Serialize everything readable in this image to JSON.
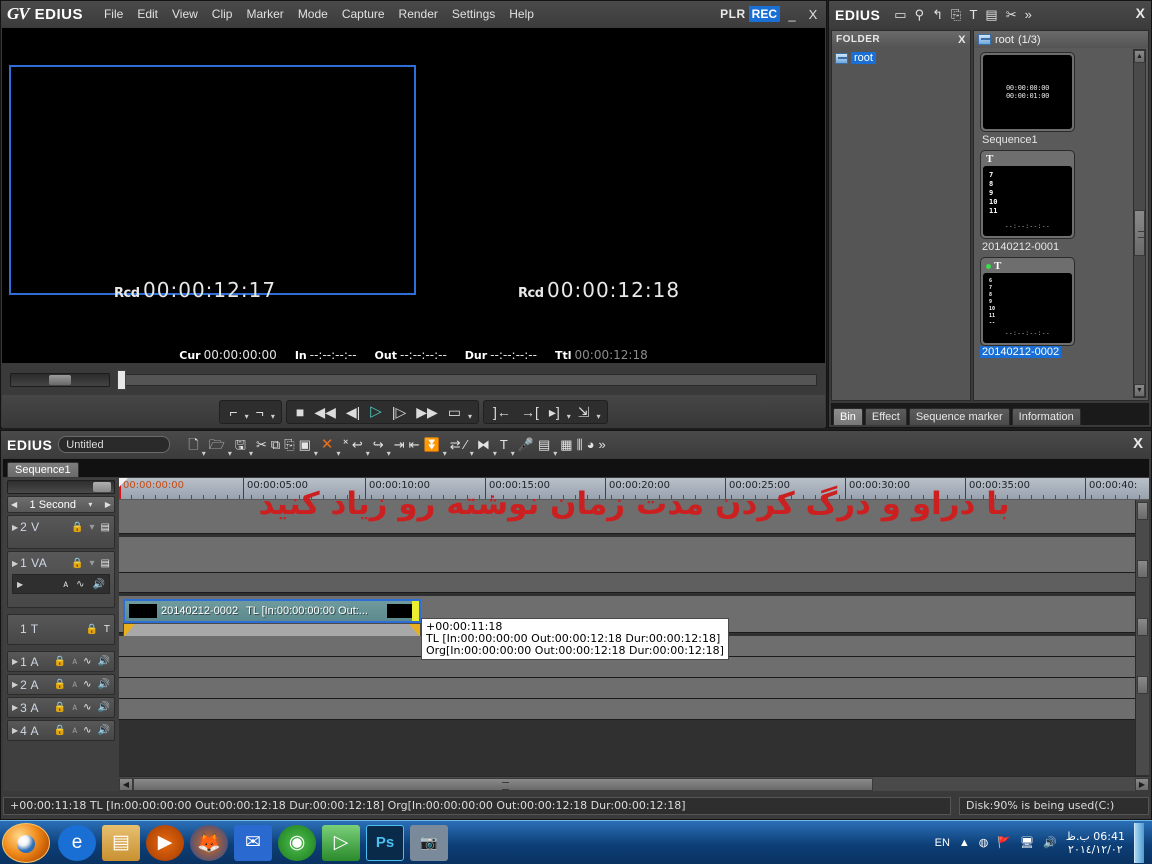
{
  "player": {
    "logo": "GV",
    "brand": "EDIUS",
    "menus": [
      "File",
      "Edit",
      "View",
      "Clip",
      "Marker",
      "Mode",
      "Capture",
      "Render",
      "Settings",
      "Help"
    ],
    "mode_plr": "PLR",
    "mode_rec": "REC",
    "minimize": "_",
    "close": "X",
    "recorder_left": {
      "label": "Rcd",
      "timecode": "00:00:12:17"
    },
    "recorder_right": {
      "label": "Rcd",
      "timecode": "00:00:12:18"
    },
    "timecodes": [
      {
        "key": "Cur",
        "value": "00:00:00:00",
        "dim": false
      },
      {
        "key": "In",
        "value": "--:--:--:--",
        "dim": false
      },
      {
        "key": "Out",
        "value": "--:--:--:--",
        "dim": false
      },
      {
        "key": "Dur",
        "value": "--:--:--:--",
        "dim": false
      },
      {
        "key": "Ttl",
        "value": "00:00:12:18",
        "dim": true
      }
    ],
    "transport": {
      "mark_in": "mark-in-icon",
      "mark_out": "mark-out-icon",
      "stop": "■",
      "rewind": "◀◀",
      "prev_frame": "◀|",
      "play": "▷",
      "next_frame": "|▷",
      "forward": "▶▶",
      "loop": "loop-icon"
    }
  },
  "bin": {
    "brand": "EDIUS",
    "toolbar_icons": [
      "folder-icon",
      "search-icon",
      "up-folder-icon",
      "add-clip-icon",
      "title-icon",
      "color-bars-icon",
      "cut-icon",
      "more-icon"
    ],
    "close": "X",
    "folder_panel": {
      "title": "FOLDER",
      "close": "X",
      "root_label": "root"
    },
    "clip_panel": {
      "path": "root",
      "count": "(1/3)"
    },
    "clips": [
      {
        "name": "Sequence1",
        "type": "sequence",
        "selected": false,
        "has_dot": false,
        "timecodes": [
          "00:00:00:00",
          "00:00:01:00"
        ],
        "numbers": ""
      },
      {
        "name": "20140212-0001",
        "type": "title",
        "selected": false,
        "has_dot": false,
        "badge": "T",
        "numbers": "7\n8\n9\n10\n11",
        "duration": "--:--:--:--"
      },
      {
        "name": "20140212-0002",
        "type": "title",
        "selected": true,
        "has_dot": true,
        "badge": "T",
        "numbers": "6\n7\n8\n9\n10\n11\n--",
        "duration": "--:--:--:--"
      }
    ],
    "tabs": [
      {
        "label": "Bin",
        "active": true
      },
      {
        "label": "Effect",
        "active": false
      },
      {
        "label": "Sequence marker",
        "active": false
      },
      {
        "label": "Information",
        "active": false
      }
    ]
  },
  "timeline": {
    "brand": "EDIUS",
    "project_name": "Untitled",
    "close": "X",
    "sequence_tab": "Sequence1",
    "toolbar_icons": [
      "new-project-icon",
      "open-project-icon",
      "save-project-icon",
      "cut-icon",
      "copy-icon",
      "paste-icon",
      "duplicate-icon",
      "delete-icon",
      "ripple-delete-icon",
      "undo-icon",
      "redo-icon",
      "add-to-timeline-icon",
      "insert-icon",
      "transition-icon",
      "sync-icon",
      "razor-icon",
      "match-frame-icon",
      "title-icon",
      "voiceover-icon",
      "export-icon",
      "layouter-icon",
      "audio-mixer-icon",
      "color-correction-icon",
      "more-icon"
    ],
    "zoom_scale": "1 Second",
    "ruler_labels": [
      "00:00:00:00",
      "00:00:05:00",
      "00:00:10:00",
      "00:00:15:00",
      "00:00:20:00",
      "00:00:25:00",
      "00:00:30:00",
      "00:00:35:00",
      "00:00:40:"
    ],
    "tracks": [
      {
        "name": "2 V",
        "kind": "video",
        "has_sub": false
      },
      {
        "name": "1 VA",
        "kind": "video-audio",
        "has_sub": true
      },
      {
        "name": "1 T",
        "kind": "title",
        "has_sub": false
      },
      {
        "name": "1 A",
        "kind": "audio",
        "has_sub": false
      },
      {
        "name": "2 A",
        "kind": "audio",
        "has_sub": false
      },
      {
        "name": "3 A",
        "kind": "audio",
        "has_sub": false
      },
      {
        "name": "4 A",
        "kind": "audio",
        "has_sub": false
      }
    ],
    "annotation_text": "با دراو و درگ کردن مدت زمان نوشته رو زیاد کنید",
    "annotation_color": "#cc2020",
    "clip": {
      "name": "20140212-0002",
      "info": "TL [In:00:00:00:00 Out:..."
    },
    "tooltip": {
      "line1": "+00:00:11:18",
      "line2": "TL [In:00:00:00:00 Out:00:00:12:18 Dur:00:00:12:18]",
      "line3": "Org[In:00:00:00:00 Out:00:00:12:18 Dur:00:00:12:18]"
    },
    "status_text": "+00:00:11:18 TL [In:00:00:00:00 Out:00:00:12:18 Dur:00:00:12:18] Org[In:00:00:00:00 Out:00:00:12:18 Dur:00:00:12:18]",
    "disk_status": "Disk:90% is being used(C:)"
  },
  "taskbar": {
    "start_label": "start-orb",
    "apps": [
      "internet-explorer-icon",
      "explorer-icon",
      "media-player-icon",
      "firefox-icon",
      "messenger-icon",
      "globe-icon",
      "edius-icon",
      "photoshop-icon",
      "camera-icon"
    ],
    "language": "EN",
    "tray_icons": [
      "show-hidden-icon",
      "action-center-icon",
      "network-error-icon",
      "removable-media-icon",
      "volume-icon"
    ],
    "time": "06:41 ب.ظ",
    "date": "٢٠١٤/١٢/٠٢"
  }
}
